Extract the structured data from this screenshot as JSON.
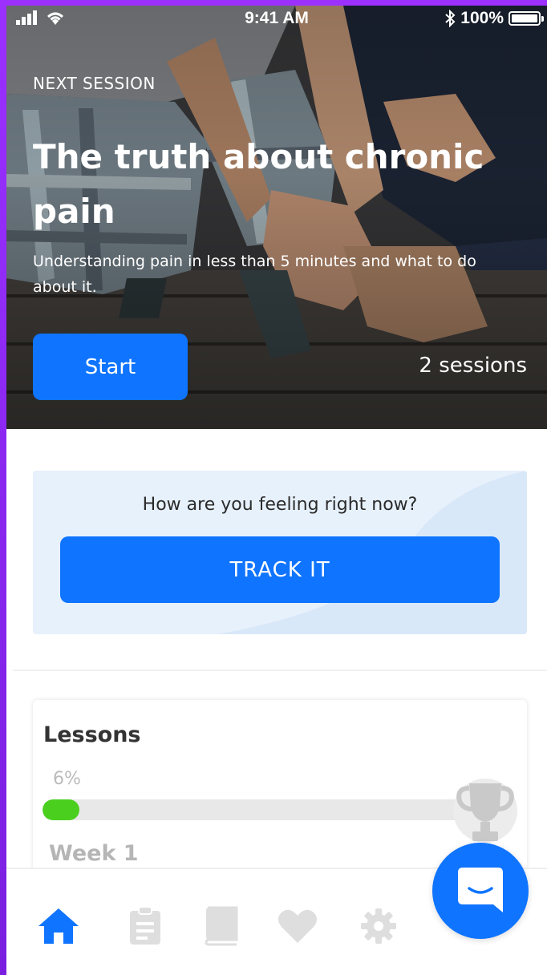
{
  "status_bar": {
    "time": "9:41 AM",
    "battery": "100%"
  },
  "hero": {
    "eyebrow": "NEXT SESSION",
    "title": "The truth about chronic pain",
    "description": "Understanding pain in less than 5 minutes and what to do about it.",
    "start_label": "Start",
    "sessions_label": "2 sessions"
  },
  "track": {
    "question": "How are you feeling right now?",
    "button_label": "TRACK IT"
  },
  "lessons": {
    "title": "Lessons",
    "percent_label": "6%",
    "progress": 0.06,
    "week_label": "Week 1"
  },
  "tabs": [
    {
      "icon": "home-icon",
      "active": true
    },
    {
      "icon": "clipboard-icon",
      "active": false
    },
    {
      "icon": "book-icon",
      "active": false
    },
    {
      "icon": "heart-icon",
      "active": false
    },
    {
      "icon": "gear-icon",
      "active": false
    }
  ],
  "colors": {
    "accent": "#0f74ff",
    "progress": "#4bcf1f",
    "inactive_icon": "#dedede",
    "frame": "#9b30ff"
  }
}
